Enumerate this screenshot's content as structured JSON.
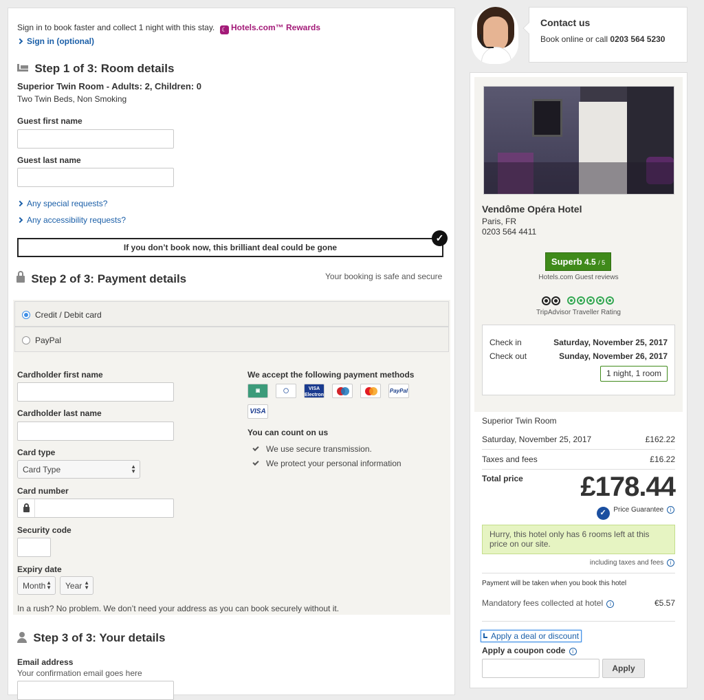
{
  "signin": {
    "prompt": "Sign in to book faster and collect 1 night with this stay.",
    "rewards": "Hotels.com™ Rewards",
    "link": "Sign in (optional)"
  },
  "step1": {
    "title": "Step 1 of 3: Room details",
    "room_title": "Superior Twin Room - Adults: 2, Children: 0",
    "room_desc": "Two Twin Beds, Non Smoking",
    "first_name_label": "Guest first name",
    "last_name_label": "Guest last name",
    "special_requests": "Any special requests?",
    "accessibility_requests": "Any accessibility requests?",
    "deal_banner": "If you don’t book now, this brilliant deal could be gone"
  },
  "step2": {
    "title": "Step 2 of 3: Payment details",
    "secure_note": "Your booking is safe and secure",
    "option_card": "Credit / Debit card",
    "option_paypal": "PayPal",
    "cardholder_first_label": "Cardholder first name",
    "cardholder_last_label": "Cardholder last name",
    "card_type_label": "Card type",
    "card_type_value": "Card Type",
    "card_number_label": "Card number",
    "security_code_label": "Security code",
    "expiry_label": "Expiry date",
    "expiry_month": "Month",
    "expiry_year": "Year",
    "accept_title": "We accept the following payment methods",
    "cards": [
      "Diners",
      "Visa Electron",
      "Maestro",
      "MasterCard",
      "PayPal",
      "VISA"
    ],
    "count_on_title": "You can count on us",
    "count_on_items": [
      "We use secure transmission.",
      "We protect your personal information"
    ],
    "address_note": "In a rush? No problem. We don’t need your address as you can book securely without it."
  },
  "step3": {
    "title": "Step 3 of 3: Your details",
    "email_label": "Email address",
    "email_hint": "Your confirmation email goes here"
  },
  "contact": {
    "title": "Contact us",
    "line_prefix": "Book online or call ",
    "phone": "0203 564 5230"
  },
  "hotel": {
    "name": "Vendôme Opéra Hotel",
    "city": "Paris, FR",
    "phone": "0203 564 4411",
    "rating_word": "Superb",
    "rating_score": "4.5",
    "rating_max": "/ 5",
    "rating_source": "Hotels.com Guest reviews",
    "tripadvisor_label": "TripAdvisor Traveller Rating",
    "tripadvisor_bubbles": 5
  },
  "stay": {
    "checkin_label": "Check in",
    "checkin_date": "Saturday, November 25, 2017",
    "checkout_label": "Check out",
    "checkout_date": "Sunday, November 26, 2017",
    "summary": "1 night, 1 room"
  },
  "price": {
    "room": "Superior Twin Room",
    "night_label": "Saturday, November 25, 2017",
    "night_price": "£162.22",
    "taxes_label": "Taxes and fees",
    "taxes_price": "£16.22",
    "total_label": "Total price",
    "total": "£178.44",
    "guarantee": "Price Guarantee",
    "hurry": "Hurry, this hotel only has 6 rooms left at this price on our site.",
    "incl_taxes": "including taxes and fees",
    "payment_note": "Payment will be taken when you book this hotel",
    "mandatory_label": "Mandatory fees collected at hotel",
    "mandatory_fee": "€5.57",
    "deal_link": "Apply a deal or discount",
    "coupon_label": "Apply a coupon code",
    "apply_button": "Apply"
  },
  "colors": {
    "link": "#1b5fa8",
    "rewards": "#a31a78",
    "rating_green": "#3f8a1a",
    "hurry_bg": "#e6f4c2"
  }
}
